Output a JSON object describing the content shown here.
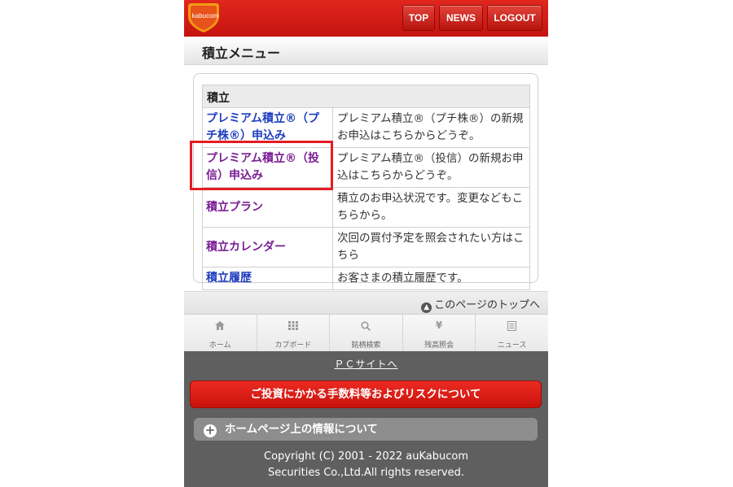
{
  "header": {
    "logo_text": "kabucom",
    "buttons": [
      "TOP",
      "NEWS",
      "LOGOUT"
    ]
  },
  "page_title": "積立メニュー",
  "menu": {
    "section_header": "積立",
    "rows": [
      {
        "link": "プレミアム積立®（プチ株®）申込み",
        "description": "プレミアム積立®（プチ株®）の新規お申込はこちらからどうぞ。"
      },
      {
        "link": "プレミアム積立®（投信）申込み",
        "description": "プレミアム積立®（投信）の新規お申込はこちらからどうぞ。"
      },
      {
        "link": "積立プラン",
        "description": "積立のお申込状況です。変更などもこちらから。"
      },
      {
        "link": "積立カレンダー",
        "description": "次回の買付予定を照会されたい方はこちら"
      },
      {
        "link": "積立履歴",
        "description": "お客さまの積立履歴です。"
      }
    ]
  },
  "to_top": "このページのトップへ",
  "bottom_nav": [
    {
      "label": "ホーム",
      "icon": "home-icon"
    },
    {
      "label": "カブボード",
      "icon": "grid-icon"
    },
    {
      "label": "銘柄検索",
      "icon": "search-icon"
    },
    {
      "label": "残高照会",
      "icon": "yen-icon"
    },
    {
      "label": "ニュース",
      "icon": "news-icon"
    }
  ],
  "footer": {
    "pc_site": "ＰＣサイトへ",
    "risk_button": "ご投資にかかる手数料等およびリスクについて",
    "info_toggle": "ホームページ上の情報について",
    "copyright_line1": "Copyright (C) 2001 - 2022 auKabucom",
    "copyright_line2": "Securities Co.,Ltd.All rights reserved."
  },
  "colors": {
    "brand_red": "#d71c16",
    "link_blue": "#1f3fbf",
    "link_visited": "#7b1e95",
    "highlight_red": "#e51c23",
    "footer_gray": "#5f5f5f"
  }
}
